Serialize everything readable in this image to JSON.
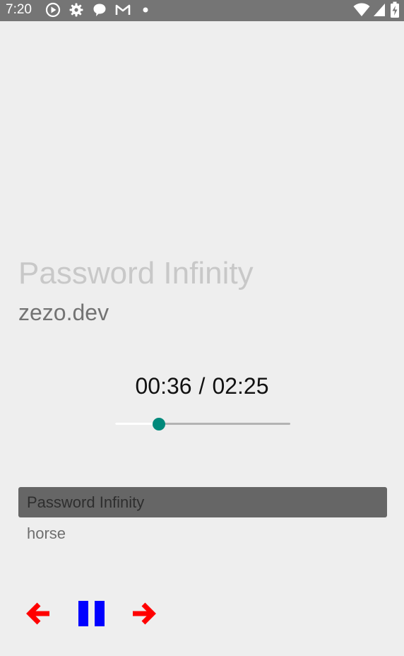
{
  "status_bar": {
    "time": "7:20",
    "icons": [
      "play-circle-icon",
      "gear-icon",
      "chat-bubble-icon",
      "gmail-icon",
      "dot-icon",
      "wifi-icon",
      "signal-icon",
      "battery-charging-icon"
    ],
    "background": "#757575"
  },
  "now_playing": {
    "title": "Password Infinity",
    "artist": "zezo.dev",
    "elapsed": "00:36",
    "separator": "/",
    "duration": "02:25",
    "progress_fraction": 0.25
  },
  "playlist": {
    "items": [
      {
        "title": "Password Infinity",
        "selected": true
      }
    ],
    "subtitle": "horse"
  },
  "controls": {
    "previous_icon": "arrow-left-icon",
    "pause_icon": "pause-icon",
    "next_icon": "arrow-right-icon"
  },
  "colors": {
    "background": "#eeeeee",
    "accent": "#00897b",
    "arrow": "#ff0000",
    "pause": "#0000ff",
    "selected_item": "#666666"
  }
}
